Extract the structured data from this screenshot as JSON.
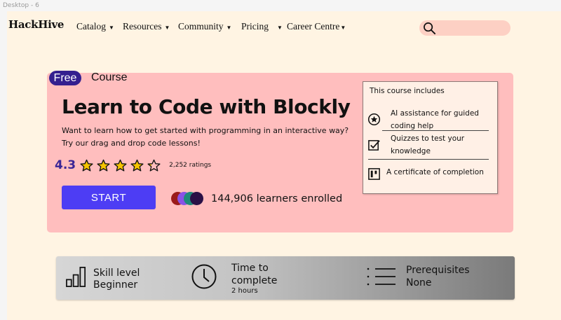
{
  "frame": {
    "label": "Desktop - 6"
  },
  "header": {
    "logo": "HackHive",
    "nav": [
      {
        "label": "Catalog"
      },
      {
        "label": "Resources"
      },
      {
        "label": "Community"
      },
      {
        "label": "Pricing"
      },
      {
        "label": "Career Centre"
      }
    ],
    "search": {
      "placeholder": ""
    }
  },
  "hero": {
    "badge": "Free",
    "type_label": "Course",
    "title": "Learn to Code with Blockly",
    "description": "Want to learn how to get started with programming in an interactive way? Try our drag and drop code lessons!",
    "rating": {
      "value": "4.3",
      "stars": 5,
      "count_label": "2,252 ratings"
    },
    "start_label": "START",
    "learners_label": "144,906 learners enrolled",
    "avatar_colors": [
      "#9b1a1a",
      "#8a52e6",
      "#1f8a7a",
      "#2a1046"
    ]
  },
  "includes": {
    "title": "This course includes",
    "items": [
      {
        "icon": "star-circle-icon",
        "line1": "AI assistance for guided",
        "line2": "coding help"
      },
      {
        "icon": "checkbox-icon",
        "line1": "Quizzes to test your",
        "line2": "knowledge"
      },
      {
        "icon": "certificate-icon",
        "line1": "A certificate of completion",
        "line2": ""
      }
    ]
  },
  "info": {
    "skill": {
      "icon": "bar-chart-icon",
      "label": "Skill level",
      "value": "Beginner"
    },
    "time": {
      "icon": "clock-icon",
      "label_line1": "Time to",
      "label_line2": "complete",
      "value": "2 hours"
    },
    "prereq": {
      "icon": "list-icon",
      "label": "Prerequisites",
      "value": "None"
    }
  },
  "colors": {
    "background": "#fff4e3",
    "hero_card": "#ffbebe",
    "accent": "#4d3df4",
    "badge": "#341f8f",
    "star": "#f5c400"
  }
}
